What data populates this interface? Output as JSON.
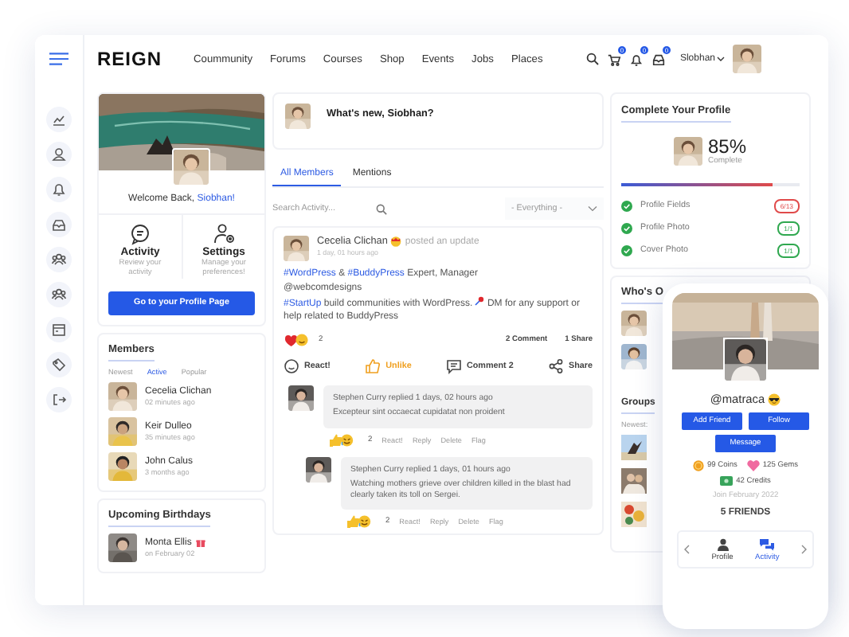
{
  "header": {
    "logo": "REIGN",
    "nav": [
      "Coummunity",
      "Forums",
      "Courses",
      "Shop",
      "Events",
      "Jobs",
      "Places"
    ],
    "notifications": [
      {
        "kind": "cart",
        "count": "0"
      },
      {
        "kind": "bell",
        "count": "0"
      },
      {
        "kind": "inbox",
        "count": "0"
      }
    ],
    "user": "Slobhan"
  },
  "profile_card": {
    "greeting": "Welcome Back,",
    "name": "Siobhan!",
    "tiles": [
      {
        "kind": "activity",
        "title": "Activity",
        "text": "Review your activity"
      },
      {
        "kind": "settings",
        "title": "Settings",
        "text": "Manage your preferences!"
      }
    ],
    "button": "Go to your Profile Page"
  },
  "members": {
    "title": "Members",
    "tabs": [
      {
        "label": "Newest",
        "selected": false
      },
      {
        "label": "Active",
        "selected": true
      },
      {
        "label": "Popular",
        "selected": false
      }
    ],
    "items": [
      {
        "name": "Cecelia Clichan",
        "time": "02 minutes ago"
      },
      {
        "name": "Keir Dulleo",
        "time": "35 minutes ago"
      },
      {
        "name": "John Calus",
        "time": "3 months ago"
      }
    ]
  },
  "birthdays": {
    "title": "Upcoming Birthdays",
    "items": [
      {
        "name": "Monta Ellis",
        "date": "on February 02"
      }
    ]
  },
  "composer": {
    "prompt": "What's new, Siobhan?"
  },
  "feed_tabs": [
    {
      "label": "All Members",
      "selected": true
    },
    {
      "label": "Mentions",
      "selected": false
    }
  ],
  "search": {
    "placeholder": "Search Activity..."
  },
  "filter": {
    "value": "- Everything -"
  },
  "post": {
    "author": "Cecelia Clichan",
    "action": "posted an update",
    "time": "1 day, 01 hours ago",
    "body": [
      {
        "kind": "tag",
        "text": "#WordPress"
      },
      {
        "kind": "text",
        "text": " & "
      },
      {
        "kind": "tag",
        "text": "#BuddyPress"
      },
      {
        "kind": "text",
        "text": " Expert, Manager"
      },
      {
        "kind": "break"
      },
      {
        "kind": "text",
        "text": "@webcomdesigns"
      },
      {
        "kind": "break"
      },
      {
        "kind": "tag",
        "text": "#StartUp"
      },
      {
        "kind": "text",
        "text": " build communities with WordPress. "
      },
      {
        "kind": "icon"
      },
      {
        "kind": "text",
        "text": " DM for any support or help related to BuddyPress"
      }
    ],
    "reaction_count": "2",
    "comments": "2 Comment",
    "shares": "1 Share",
    "actions": [
      {
        "kind": "react",
        "label": "React!",
        "active": false
      },
      {
        "kind": "like",
        "label": "Unlike",
        "active": true
      },
      {
        "kind": "comment",
        "label": "Comment 2",
        "active": false
      },
      {
        "kind": "share",
        "label": "Share",
        "active": false
      }
    ],
    "replies": [
      {
        "author": "Stephen Curry",
        "meta": "replied 1 days, 02 hours ago",
        "text": "Excepteur sint occaecat cupidatat non proident",
        "reaction_count": "2",
        "links": [
          "React!",
          "Reply",
          "Delete",
          "Flag"
        ],
        "children": [
          {
            "author": "Stephen Curry",
            "meta": "replied 1 days, 01 hours ago",
            "text": "Watching mothers grieve over children killed in the blast had clearly taken its toll on Sergei.",
            "reaction_count": "2",
            "links": [
              "React!",
              "Reply",
              "Delete",
              "Flag"
            ]
          }
        ]
      }
    ]
  },
  "profile_completion": {
    "title": "Complete Your Profile",
    "percent": "85%",
    "label": "Complete",
    "level": 0.85,
    "items": [
      {
        "label": "Profile Fields",
        "count": "6/13",
        "complete": false
      },
      {
        "label": "Profile Photo",
        "count": "1/1",
        "complete": true
      },
      {
        "label": "Cover Photo",
        "count": "1/1",
        "complete": true
      }
    ]
  },
  "whos_online": {
    "title": "Who's O"
  },
  "groups": {
    "title": "Groups",
    "tabs": [
      {
        "label": "Newest:",
        "selected": false
      }
    ]
  },
  "phone": {
    "handle": "@matraca",
    "buttons": [
      "Add Friend",
      "Follow",
      "Message"
    ],
    "stats": [
      {
        "kind": "coins",
        "label": "99 Coins"
      },
      {
        "kind": "gems",
        "label": "125 Gems"
      },
      {
        "kind": "credits",
        "label": "42 Credits"
      }
    ],
    "joined": "Join February 2022",
    "friends": "5 FRIENDS",
    "nav": [
      {
        "kind": "profile",
        "label": "Profile",
        "selected": false
      },
      {
        "kind": "activity",
        "label": "Activity",
        "selected": true
      }
    ]
  }
}
